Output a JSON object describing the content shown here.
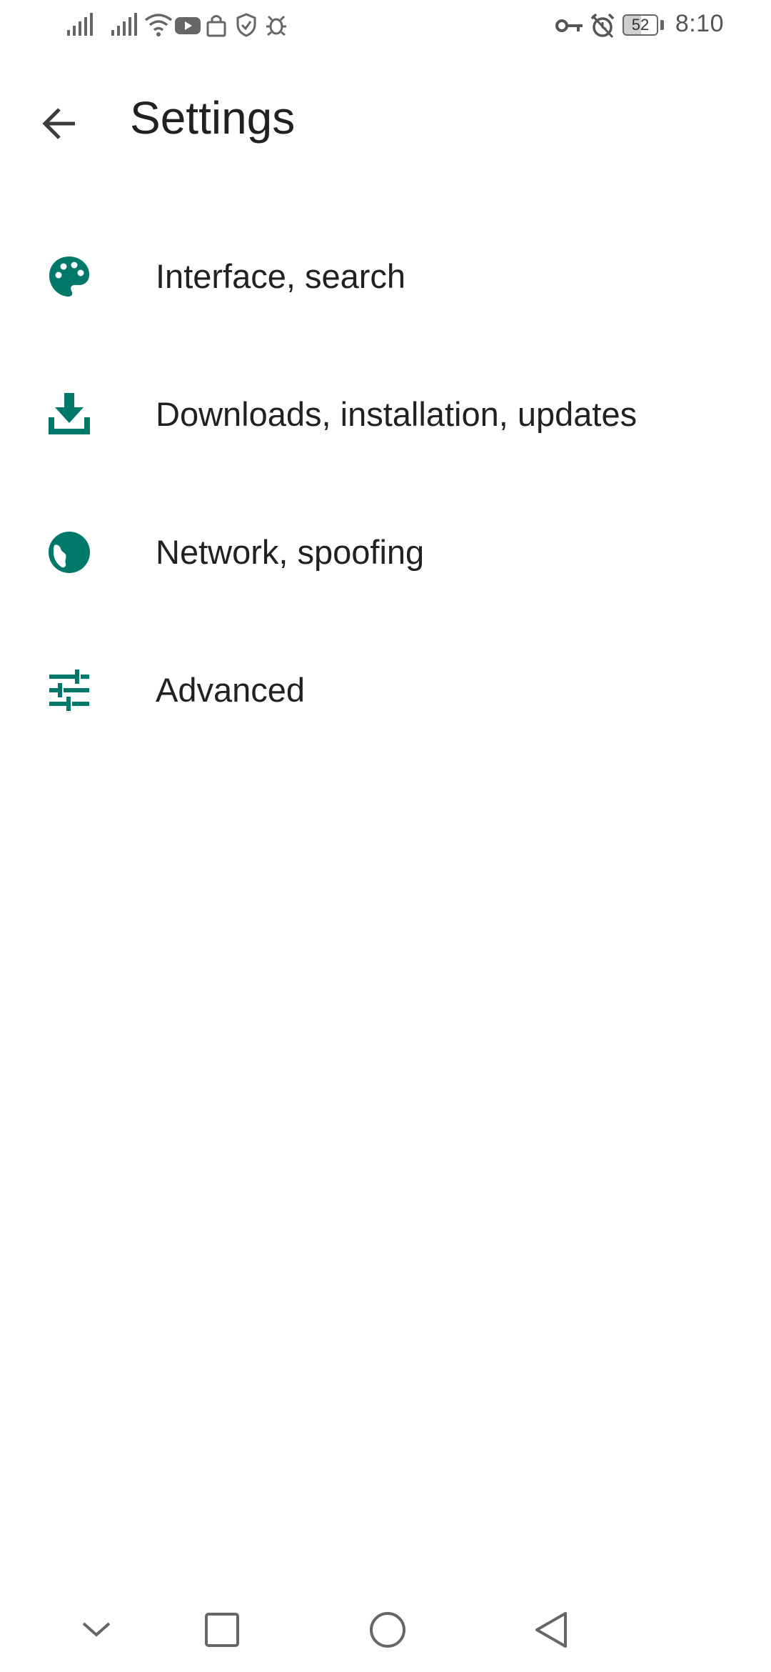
{
  "status_bar": {
    "time": "8:10",
    "battery_level": "52",
    "icons": [
      "signal-icon",
      "signal-icon",
      "wifi-icon",
      "youtube-icon",
      "lock-icon",
      "shield-icon",
      "bug-icon",
      "vpn-key-icon",
      "alarm-icon",
      "battery-icon"
    ]
  },
  "app_bar": {
    "title": "Settings",
    "back_icon": "arrow-back-icon"
  },
  "settings": {
    "accent_color": "#00796B",
    "items": [
      {
        "label": "Interface, search",
        "icon": "palette-icon"
      },
      {
        "label": "Downloads, installation, updates",
        "icon": "download-icon"
      },
      {
        "label": "Network, spoofing",
        "icon": "globe-icon"
      },
      {
        "label": "Advanced",
        "icon": "tune-icon"
      }
    ]
  },
  "nav_bar": {
    "icons": [
      "chevron-down-icon",
      "recents-square-icon",
      "home-circle-icon",
      "back-triangle-icon"
    ]
  }
}
